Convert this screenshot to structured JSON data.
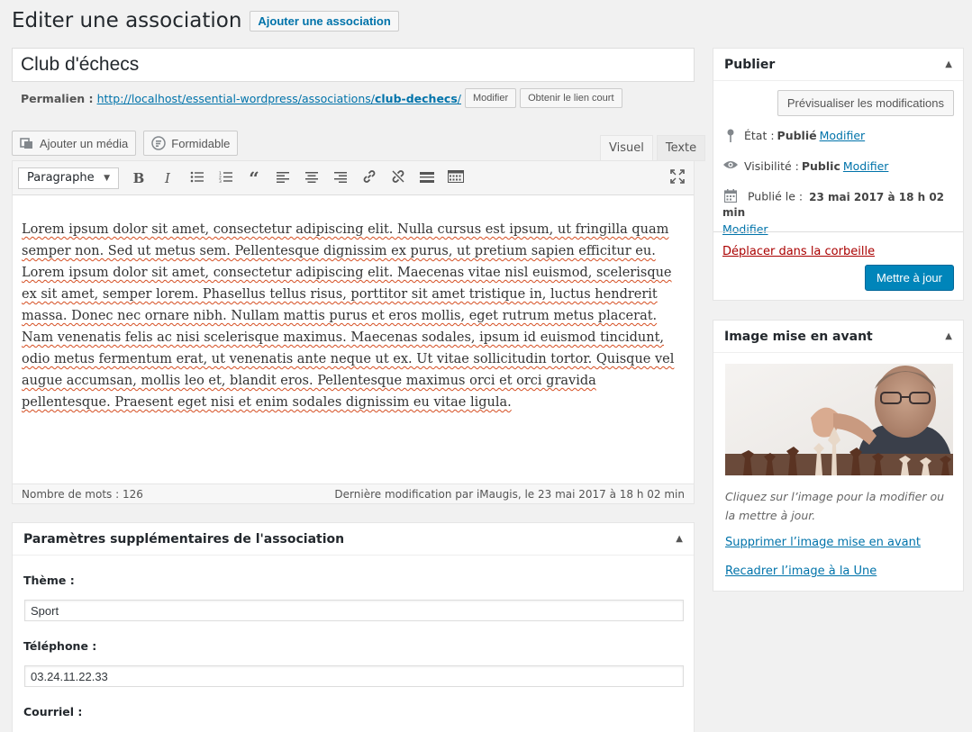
{
  "header": {
    "title": "Editer une association",
    "add_button": "Ajouter une association"
  },
  "post": {
    "title": "Club d'échecs"
  },
  "permalink": {
    "label": "Permalien :",
    "url_base": "http://localhost/essential-wordpress/associations/",
    "slug": "club-dechecs",
    "url_end": "/",
    "modify_button": "Modifier",
    "shortlink_button": "Obtenir le lien court"
  },
  "media": {
    "add_media": "Ajouter un média",
    "formidable": "Formidable"
  },
  "editor_tabs": {
    "visual": "Visuel",
    "text": "Texte"
  },
  "toolbar": {
    "format_select": "Paragraphe"
  },
  "editor": {
    "content": "Lorem ipsum dolor sit amet, consectetur adipiscing elit. Nulla cursus est ipsum, ut fringilla quam semper non. Sed ut metus sem. Pellentesque dignissim ex purus, ut pretium sapien efficitur eu. Lorem ipsum dolor sit amet, consectetur adipiscing elit. Maecenas vitae nisl euismod, scelerisque ex sit amet, semper lorem. Phasellus tellus risus, porttitor sit amet tristique in, luctus hendrerit massa. Donec nec ornare nibh. Nullam mattis purus et eros mollis, eget rutrum metus placerat. Nam venenatis felis ac nisi scelerisque maximus. Maecenas sodales, ipsum id euismod tincidunt, odio metus fermentum erat, ut venenatis ante neque ut ex. Ut vitae sollicitudin tortor. Quisque vel augue accumsan, mollis leo et, blandit eros. Pellentesque maximus orci et orci gravida pellentesque. Praesent eget nisi et enim sodales dignissim eu vitae ligula.",
    "word_count": "Nombre de mots : 126",
    "last_modified": "Dernière modification par iMaugis, le 23 mai 2017 à 18 h 02 min"
  },
  "meta_box": {
    "title": "Paramètres supplémentaires de l'association",
    "theme_label": "Thème :",
    "theme_value": "Sport",
    "phone_label": "Téléphone :",
    "phone_value": "03.24.11.22.33",
    "email_label": "Courriel :"
  },
  "publish": {
    "title": "Publier",
    "preview_button": "Prévisualiser les modifications",
    "status_label": "État :",
    "status_value": "Publié",
    "status_edit": "Modifier",
    "visibility_label": "Visibilité :",
    "visibility_value": "Public",
    "visibility_edit": "Modifier",
    "published_label": "Publié le :",
    "published_value": "23 mai 2017 à 18 h 02 min",
    "published_edit": "Modifier",
    "trash": "Déplacer dans la corbeille",
    "update_button": "Mettre à jour"
  },
  "featured_image": {
    "title": "Image mise en avant",
    "caption": "Cliquez sur l’image pour la modifier ou la mettre à jour.",
    "remove": "Supprimer l’image mise en avant",
    "crop": "Recadrer l’image à la Une"
  },
  "colors": {
    "primary": "#0085ba",
    "link": "#0073aa",
    "danger": "#a00"
  }
}
